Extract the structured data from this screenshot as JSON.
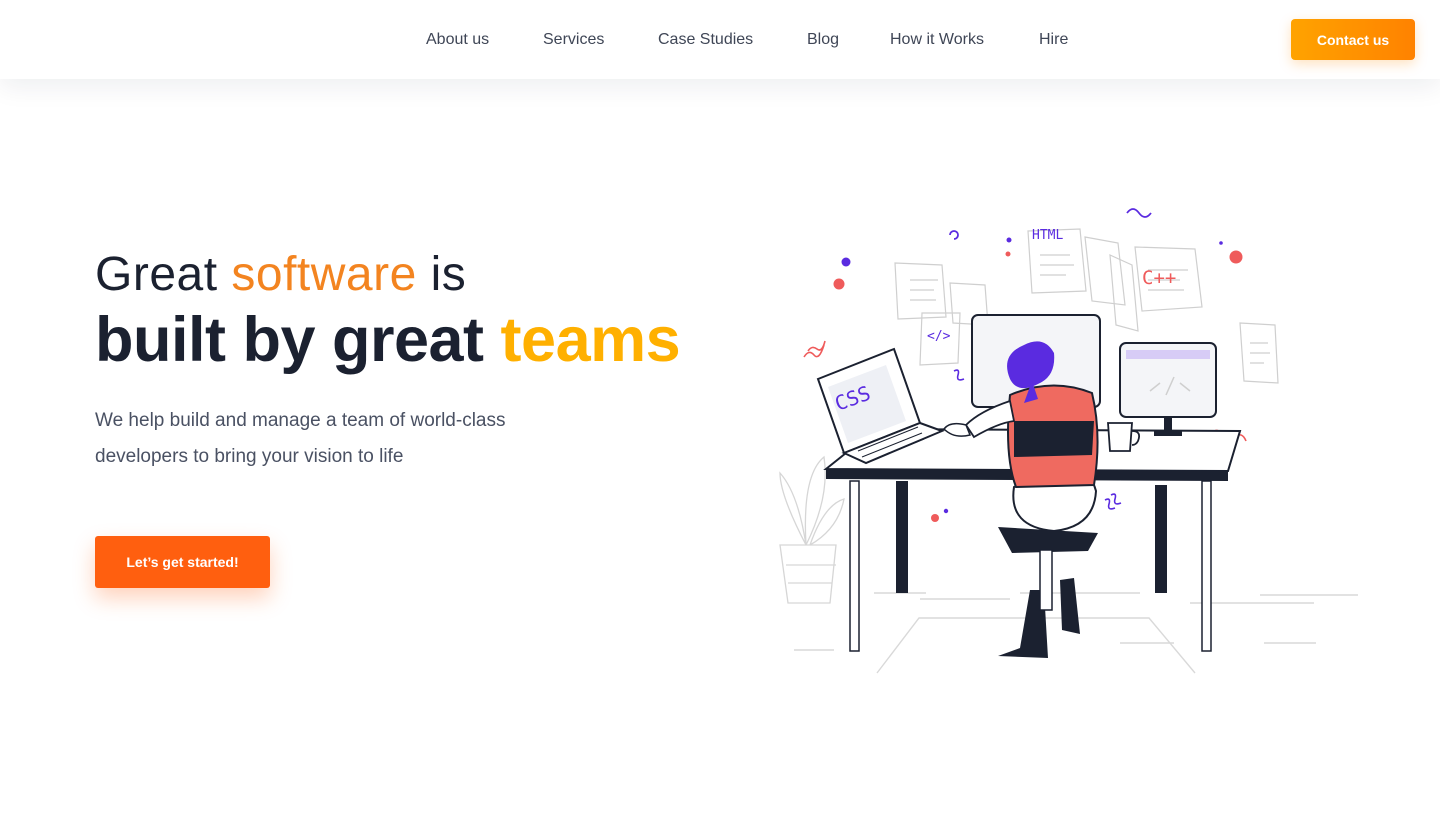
{
  "header": {
    "nav": [
      "About us",
      "Services",
      "Case Studies",
      "Blog",
      "How it Works",
      "Hire"
    ],
    "contact_label": "Contact us"
  },
  "hero": {
    "title_part1": "Great ",
    "title_highlight1": "software",
    "title_part2": " is",
    "title2_part1": "built by great ",
    "title2_highlight": "teams",
    "subtitle": "We help build and manage a team of world-class developers to bring your vision to life",
    "cta_label": "Let’s get started!"
  },
  "illustration": {
    "labels": [
      "HTML",
      "C++",
      "CSS",
      "</>"
    ],
    "colors": {
      "accent_purple": "#5a2be0",
      "accent_red": "#ef5b5b",
      "orange": "#ff8200"
    }
  }
}
